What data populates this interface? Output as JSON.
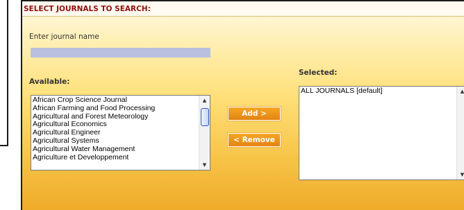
{
  "header": {
    "title": "SELECT JOURNALS TO SEARCH:"
  },
  "journal_search": {
    "label": "Enter journal name",
    "value": "",
    "placeholder": ""
  },
  "available": {
    "label": "Available:",
    "items": [
      "African Crop Science Journal",
      "African Farming and Food Processing",
      "Agricultural and Forest Meteorology",
      "Agricultural Economics",
      "Agricultural Engineer",
      "Agricultural Systems",
      "Agricultural Water Management",
      "Agriculture et Developpement"
    ]
  },
  "selected": {
    "label": "Selected:",
    "items": [
      "ALL JOURNALS [default]"
    ]
  },
  "buttons": {
    "add": "Add >",
    "remove": "< Remove"
  },
  "scroll": {
    "up_glyph": "▲",
    "down_glyph": "▼"
  },
  "colors": {
    "header_text": "#8b1010",
    "button": "#f5a623",
    "input_fill": "#b8bfdf",
    "panel_gradient_bottom": "#efab2a"
  }
}
